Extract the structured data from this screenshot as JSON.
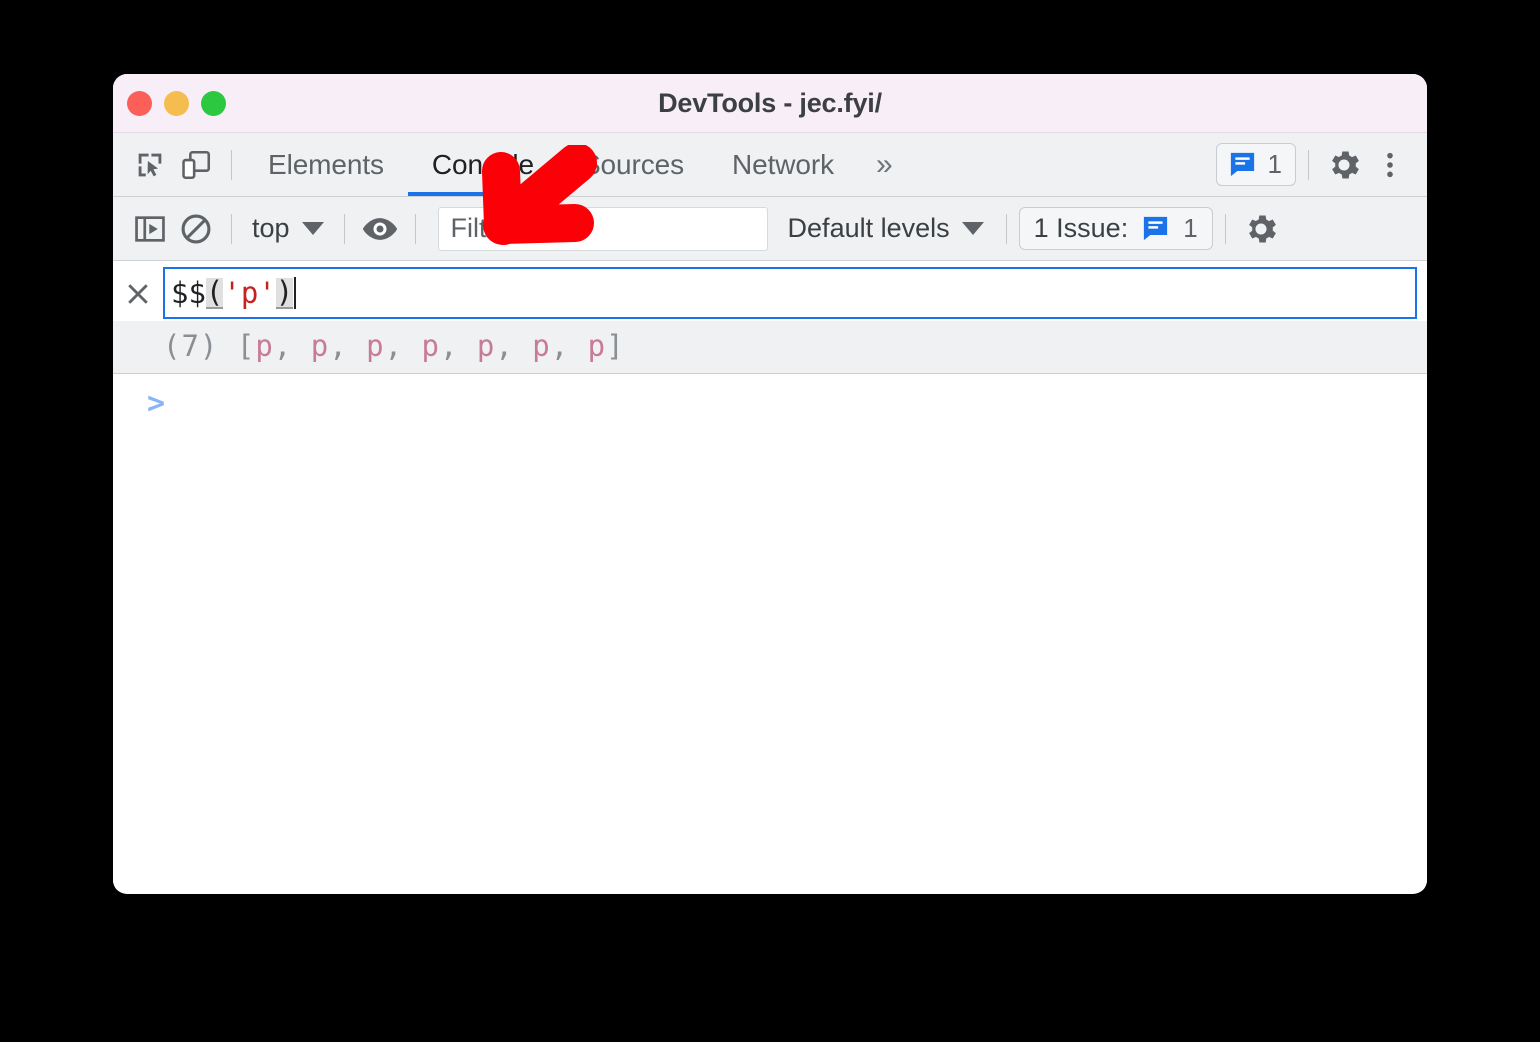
{
  "window": {
    "title": "DevTools - jec.fyi/",
    "traffic_lights": [
      {
        "name": "close",
        "color": "#fb5f57"
      },
      {
        "name": "minimize",
        "color": "#f5bd4f"
      },
      {
        "name": "maximize",
        "color": "#2cc840"
      }
    ]
  },
  "tabbar": {
    "inspect_icon": "inspect-element-icon",
    "device_icon": "device-toolbar-icon",
    "tabs": [
      {
        "label": "Elements",
        "active": false
      },
      {
        "label": "Console",
        "active": true
      },
      {
        "label": "Sources",
        "active": false
      },
      {
        "label": "Network",
        "active": false
      }
    ],
    "more_tabs": "»",
    "issue_chip": {
      "icon": "issue-message-icon",
      "count": "1"
    },
    "settings_icon": "gear-icon",
    "menu_icon": "three-dot-menu-icon"
  },
  "console_toolbar": {
    "sidebar_toggle_icon": "show-console-sidebar-icon",
    "clear_icon": "clear-console-icon",
    "context": {
      "label": "top",
      "caret": "▼"
    },
    "eye_icon": "live-expression-eye-icon",
    "filter": {
      "value": "",
      "placeholder": "Filter"
    },
    "levels": {
      "label": "Default levels",
      "caret": "▼"
    },
    "issues": {
      "label": "1 Issue:",
      "icon": "issue-message-icon",
      "count": "1"
    },
    "settings_icon": "gear-icon"
  },
  "console": {
    "close_icon": "close-entry-icon",
    "input": {
      "prefix": "$$",
      "open_paren": "(",
      "quote_open": "'",
      "string": "p",
      "quote_close": "'",
      "close_paren": ")"
    },
    "result": {
      "count": "(7)",
      "open_bracket": "[",
      "items": [
        "p",
        "p",
        "p",
        "p",
        "p",
        "p",
        "p"
      ],
      "separator": ", ",
      "close_bracket": "]"
    },
    "prompt": ">"
  },
  "annotation": {
    "arrow": {
      "name": "red-pointer-arrow",
      "color": "#fb0007",
      "direction": "down-left"
    }
  },
  "colors": {
    "titlebar_bg": "#f7eef7",
    "toolbar_bg": "#eff1f2",
    "accent_blue": "#1a73e8",
    "prompt_blue": "#8ab4f8",
    "result_gray": "#8a8f94",
    "element_pink": "#c87b94",
    "string_red": "#c5221f"
  }
}
